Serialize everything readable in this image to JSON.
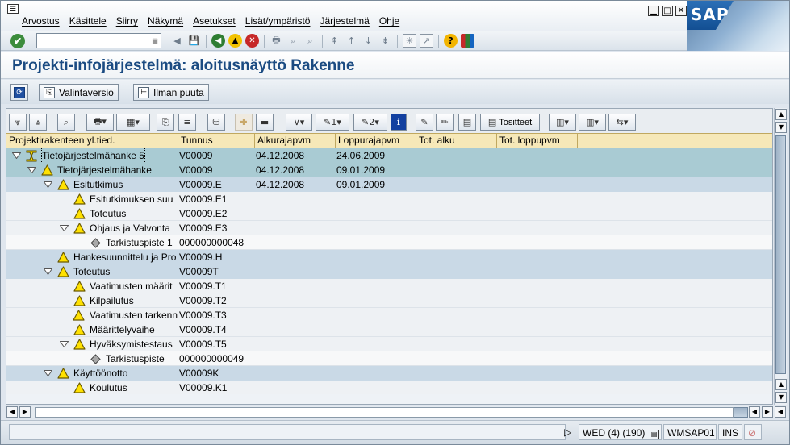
{
  "menu": [
    "Arvostus",
    "Käsittele",
    "Siirry",
    "Näkymä",
    "Asetukset",
    "Lisät/ympäristö",
    "Järjestelmä",
    "Ohje"
  ],
  "window_buttons": [
    "minimize",
    "maximize",
    "close"
  ],
  "logo": "SAP",
  "command_field": {
    "value": ""
  },
  "page_title": "Projekti-infojärjestelmä: aloitusnäyttö Rakenne",
  "app_toolbar": {
    "valintaversio": "Valintaversio",
    "ilman_puuta": "Ilman puuta"
  },
  "alv_toolbar": {
    "tositteet": "Tositteet"
  },
  "columns": [
    "Projektirakenteen yl.tied.",
    "Tunnus",
    "Alkurajapvm",
    "Loppurajapvm",
    "Tot. alku",
    "Tot. loppupvm"
  ],
  "rows": [
    {
      "level": 0,
      "icon": "project-icon",
      "expanded": true,
      "name": "Tietojärjestelmähanke 5",
      "id": "V00009",
      "start": "04.12.2008",
      "end": "24.06.2009"
    },
    {
      "level": 1,
      "icon": "warning-icon",
      "expanded": true,
      "name": "Tietojärjestelmähanke",
      "id": "V00009",
      "start": "04.12.2008",
      "end": "09.01.2009"
    },
    {
      "level": 2,
      "icon": "warning-icon",
      "expanded": true,
      "name": "Esitutkimus",
      "id": "V00009.E",
      "start": "04.12.2008",
      "end": "09.01.2009"
    },
    {
      "level": 3,
      "icon": "warning-icon",
      "expanded": null,
      "name": "Esitutkimuksen suu",
      "id": "V00009.E1",
      "start": "",
      "end": ""
    },
    {
      "level": 3,
      "icon": "warning-icon",
      "expanded": null,
      "name": "Toteutus",
      "id": "V00009.E2",
      "start": "",
      "end": ""
    },
    {
      "level": 3,
      "icon": "warning-icon",
      "expanded": true,
      "name": "Ohjaus ja Valvonta",
      "id": "V00009.E3",
      "start": "",
      "end": ""
    },
    {
      "level": 4,
      "icon": "milestone-icon",
      "expanded": null,
      "name": "Tarkistuspiste 1",
      "id": "000000000048",
      "start": "",
      "end": ""
    },
    {
      "level": 2,
      "icon": "warning-icon",
      "expanded": null,
      "name": "Hankesuunnittelu ja Pro",
      "id": "V00009.H",
      "start": "",
      "end": ""
    },
    {
      "level": 2,
      "icon": "warning-icon",
      "expanded": true,
      "name": "Toteutus",
      "id": "V00009T",
      "start": "",
      "end": ""
    },
    {
      "level": 3,
      "icon": "warning-icon",
      "expanded": null,
      "name": "Vaatimusten määrit",
      "id": "V00009.T1",
      "start": "",
      "end": ""
    },
    {
      "level": 3,
      "icon": "warning-icon",
      "expanded": null,
      "name": "Kilpailutus",
      "id": "V00009.T2",
      "start": "",
      "end": ""
    },
    {
      "level": 3,
      "icon": "warning-icon",
      "expanded": null,
      "name": "Vaatimusten tarkenn",
      "id": "V00009.T3",
      "start": "",
      "end": ""
    },
    {
      "level": 3,
      "icon": "warning-icon",
      "expanded": null,
      "name": "Määrittelyvaihe",
      "id": "V00009.T4",
      "start": "",
      "end": ""
    },
    {
      "level": 3,
      "icon": "warning-icon",
      "expanded": true,
      "name": "Hyväksymistestaus",
      "id": "V00009.T5",
      "start": "",
      "end": ""
    },
    {
      "level": 4,
      "icon": "milestone-icon",
      "expanded": null,
      "name": "Tarkistuspiste",
      "id": "000000000049",
      "start": "",
      "end": ""
    },
    {
      "level": 2,
      "icon": "warning-icon",
      "expanded": true,
      "name": "Käyttöönotto",
      "id": "V00009K",
      "start": "",
      "end": ""
    },
    {
      "level": 3,
      "icon": "warning-icon",
      "expanded": null,
      "name": "Koulutus",
      "id": "V00009.K1",
      "start": "",
      "end": ""
    }
  ],
  "status": {
    "session": "WED (4) (190)",
    "server": "WMSAP01",
    "mode": "INS"
  }
}
